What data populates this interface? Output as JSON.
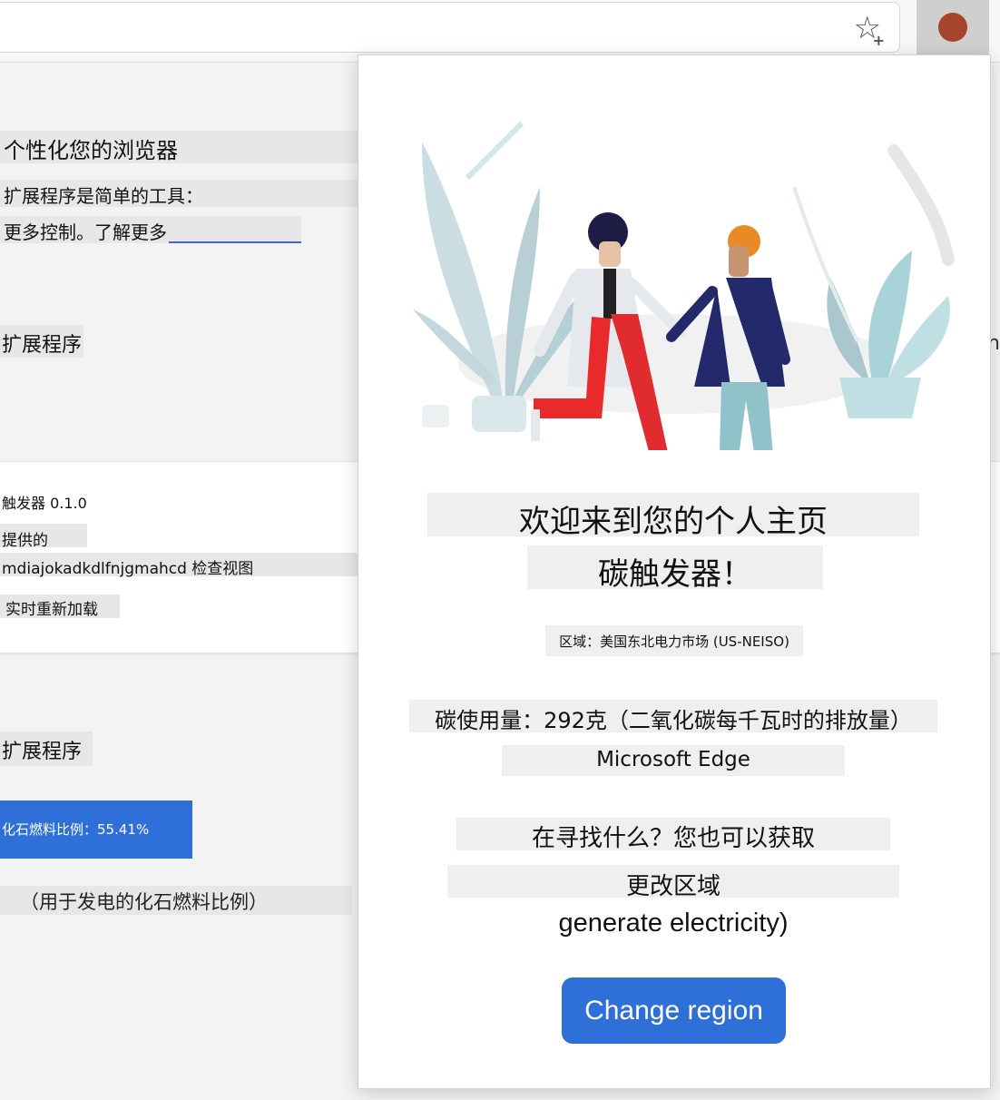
{
  "toolbar": {
    "favorite_icon": "star-plus-icon",
    "extension_icon": "extension-dot-icon",
    "extension_color": "#a6442c"
  },
  "background": {
    "title": "个性化您的浏览器",
    "desc_line1": "扩展程序是简单的工具：",
    "desc_line2": "更多控制。了解更多",
    "section1": "扩展程序",
    "extension_name": "触发器 0.1.0",
    "provided_by": "提供的",
    "extension_id": "mdiajokadkdlfnjgmahcd 检查视图",
    "reload": "实时重新加载",
    "section2": "扩展程序",
    "fossil_button": "化石燃料比例：55.41%",
    "fossil_note": "（用于发电的化石燃料比例）",
    "edge_letter": "n"
  },
  "popup": {
    "welcome_line1": "欢迎来到您的个人主页",
    "welcome_line2": "碳触发器！",
    "region": "区域：美国东北电力市场 (US-NEISO)",
    "carbon_usage": "碳使用量：292克（二氧化碳每千瓦时的排放量）",
    "browser": "Microsoft Edge",
    "looking_for": "在寻找什么？您也可以获取",
    "change_region_text": "更改区域",
    "generate": "generate electricity)",
    "change_button": "Change region"
  },
  "colors": {
    "accent": "#2f6fd8",
    "highlight": "#efefef"
  }
}
